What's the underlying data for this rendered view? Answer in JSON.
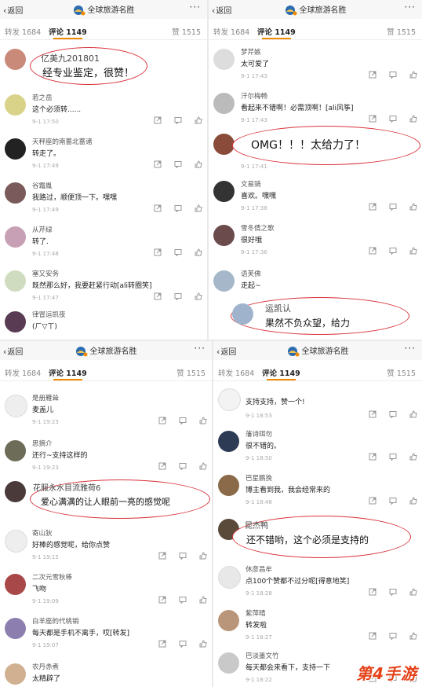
{
  "header": {
    "back_label": "返回",
    "account_name": "全球旅游名胜",
    "more_label": "···"
  },
  "tabs": {
    "reposts": "转发 1684",
    "comments": "评论 1149",
    "likes": "赞 1515"
  },
  "panels": [
    {
      "comments": [
        {
          "name": "亿美九201801",
          "text": "经专业鉴定，很赞！",
          "time": "",
          "highlight": true
        },
        {
          "name": "若之岳",
          "text": "这个必须转......",
          "time": "9-1 17:50"
        },
        {
          "name": "天秤座的南蔷北蔷诸",
          "text": "转走了。",
          "time": "9-1 17:49"
        },
        {
          "name": "谷霜胤",
          "text": "我路过，顺便顶一下。嘿嘿",
          "time": "9-1 17:49"
        },
        {
          "name": "从芹绿",
          "text": "转了.",
          "time": "9-1 17:48"
        },
        {
          "name": "塞又安务",
          "text": "既然那么好，我要赶紧行动[ali转圈笑]",
          "time": "9-1 17:47"
        },
        {
          "name": "律冒运凯夜",
          "text": "(ㄏ▽ㄒ)",
          "time": ""
        }
      ]
    },
    {
      "comments": [
        {
          "name": "梦芹嫉",
          "text": "太可爱了",
          "time": "9-1 17:43"
        },
        {
          "name": "汗尔梅畅",
          "text": "看起来不错啊！必需顶啊！[ali风筝]",
          "time": "9-1 17:43"
        },
        {
          "name": "",
          "text": "OMG！！！太给力了！",
          "time": "9-1 17:41",
          "highlight": true
        },
        {
          "name": "文易骑",
          "text": "喜欢。嘿嘿",
          "time": "9-1 17:38"
        },
        {
          "name": "雪冬倩之歌",
          "text": "很好哦",
          "time": "9-1 17:36"
        },
        {
          "name": "语芙佛",
          "text": "走起~",
          "time": ""
        },
        {
          "name": "运凯认",
          "text": "果然不负众望，给力",
          "time": "",
          "highlight": true
        }
      ]
    },
    {
      "comments": [
        {
          "name": "是册雁耸",
          "text": "麦盖儿",
          "time": "9-1 19:23"
        },
        {
          "name": "思摘介",
          "text": "还行~支持这样的",
          "time": "9-1 19:23"
        },
        {
          "name": "花服永水目流雅荷6",
          "text": "爱心满满的让人眼前一亮的感觉呢",
          "time": "",
          "highlight": true
        },
        {
          "name": "寄山狄",
          "text": "好棒的感觉呢，给你点赞",
          "time": "9-1 19:15"
        },
        {
          "name": "二次元雪秋棒",
          "text": "飞吻",
          "time": "9-1 19:09"
        },
        {
          "name": "白羊座的代桃销",
          "text": "每天都是手机不离手，哎[转发]",
          "time": "9-1 19:07"
        },
        {
          "name": "农丹赤煮",
          "text": "太精辟了",
          "time": ""
        }
      ]
    },
    {
      "comments": [
        {
          "name": "",
          "text": "支持支持，赞一个!",
          "time": "9-1 18:53"
        },
        {
          "name": "藩诗珥勿",
          "text": "很不错的。",
          "time": "9-1 18:50"
        },
        {
          "name": "巴星鹏挽",
          "text": "博主看到我，我会经常来的",
          "time": "9-1 18:48"
        },
        {
          "name": "昆杰鸭",
          "text": "还不错哟，这个必须是支持的",
          "time": "",
          "highlight": true
        },
        {
          "name": "休彦昌牟",
          "text": "点100个赞都不过分呢[得意地笑]",
          "time": "9-1 18:28"
        },
        {
          "name": "紫萍晴",
          "text": "转发啦",
          "time": "9-1 18:27"
        },
        {
          "name": "巴淡墨文竹",
          "text": "每天都会来看下，支持一下",
          "time": "9-1 18:22"
        }
      ]
    }
  ],
  "watermark": "第4手游",
  "colors": {
    "accent": "#f08a00",
    "highlight": "#d8323a",
    "watermark": "#e5421a"
  }
}
